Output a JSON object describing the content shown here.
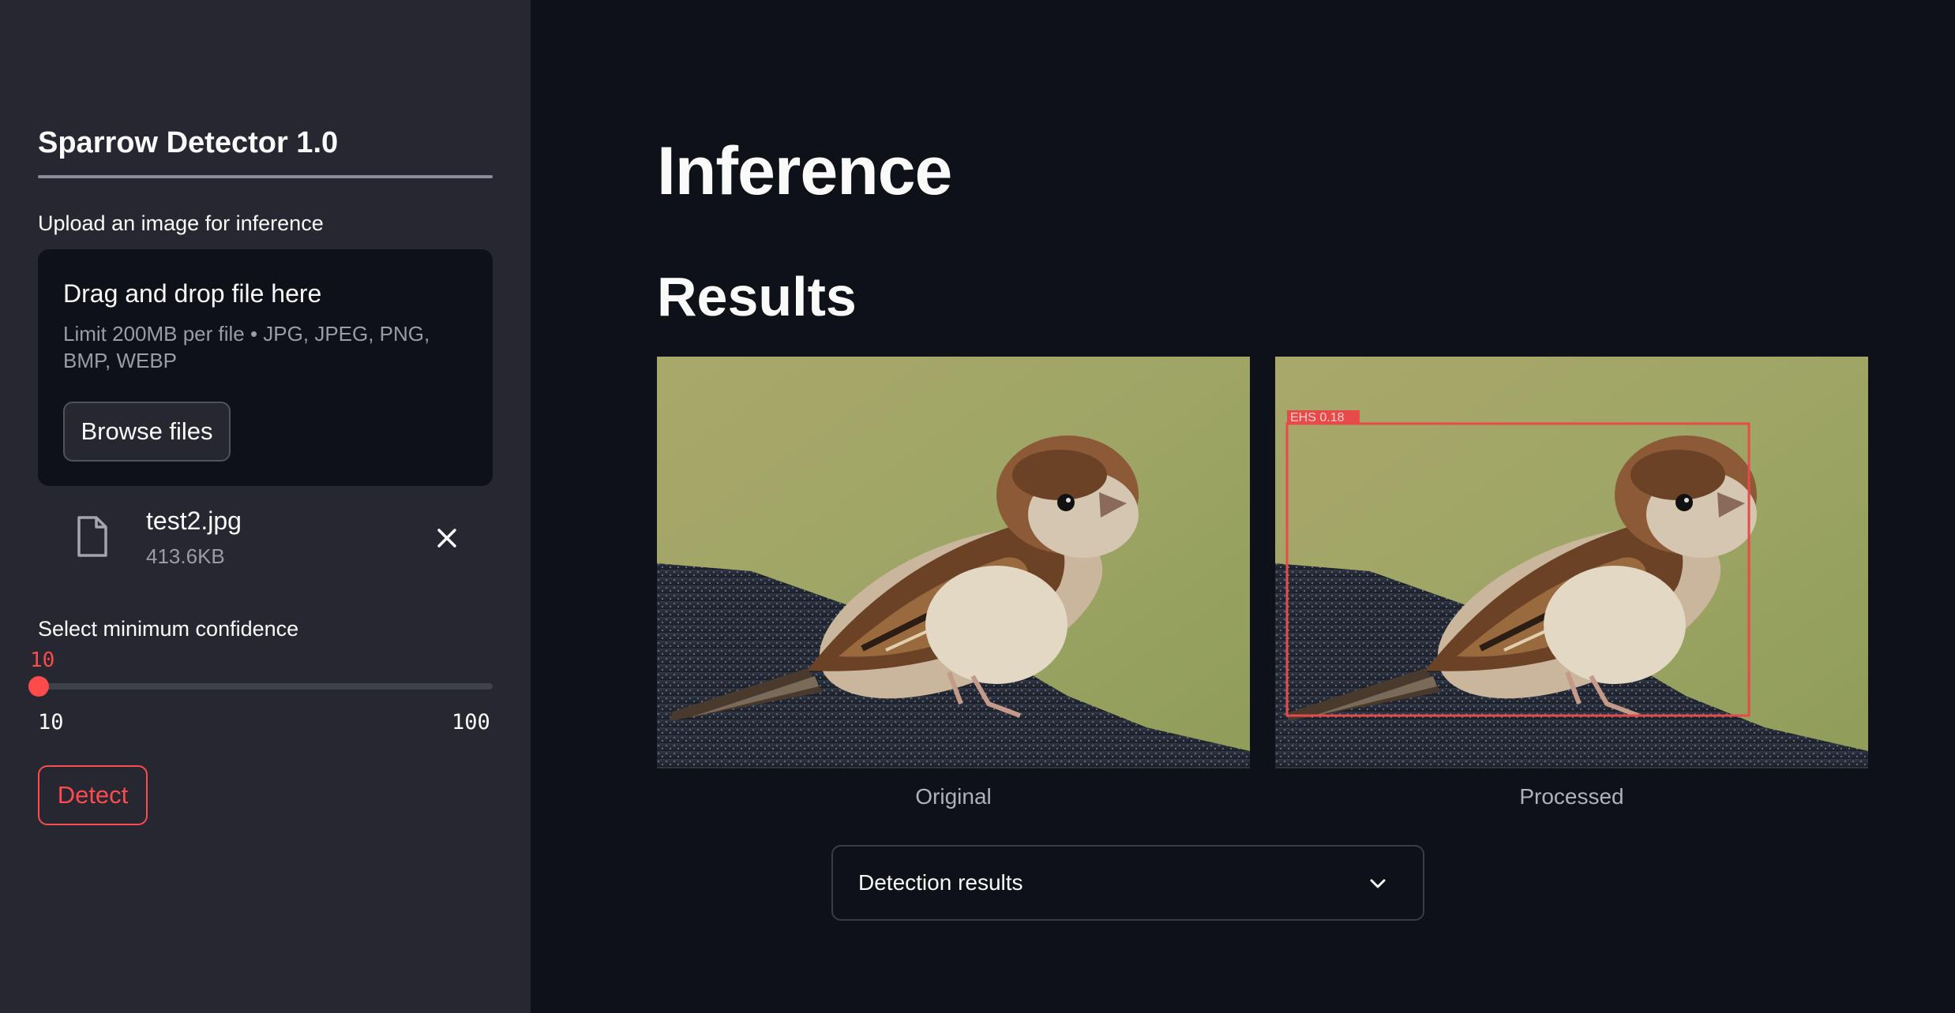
{
  "sidebar": {
    "title": "Sparrow Detector 1.0",
    "upload_label": "Upload an image for inference",
    "dropzone": {
      "title": "Drag and drop file here",
      "limit_text": "Limit 200MB per file • JPG, JPEG, PNG, BMP, WEBP",
      "browse_label": "Browse files"
    },
    "file": {
      "name": "test2.jpg",
      "size": "413.6KB",
      "icon": "file-icon",
      "remove_icon": "close-icon"
    },
    "slider": {
      "label": "Select minimum confidence",
      "value": "10",
      "min": "10",
      "max": "100"
    },
    "detect_label": "Detect"
  },
  "main": {
    "title": "Inference",
    "section": "Results",
    "images": [
      {
        "caption": "Original"
      },
      {
        "caption": "Processed",
        "detection_label": "EHS  0.18"
      }
    ],
    "expander": {
      "label": "Detection results",
      "icon": "chevron-down-icon"
    }
  },
  "colors": {
    "background": "#0e1117",
    "sidebar": "#262730",
    "accent": "#ff4b4b"
  }
}
